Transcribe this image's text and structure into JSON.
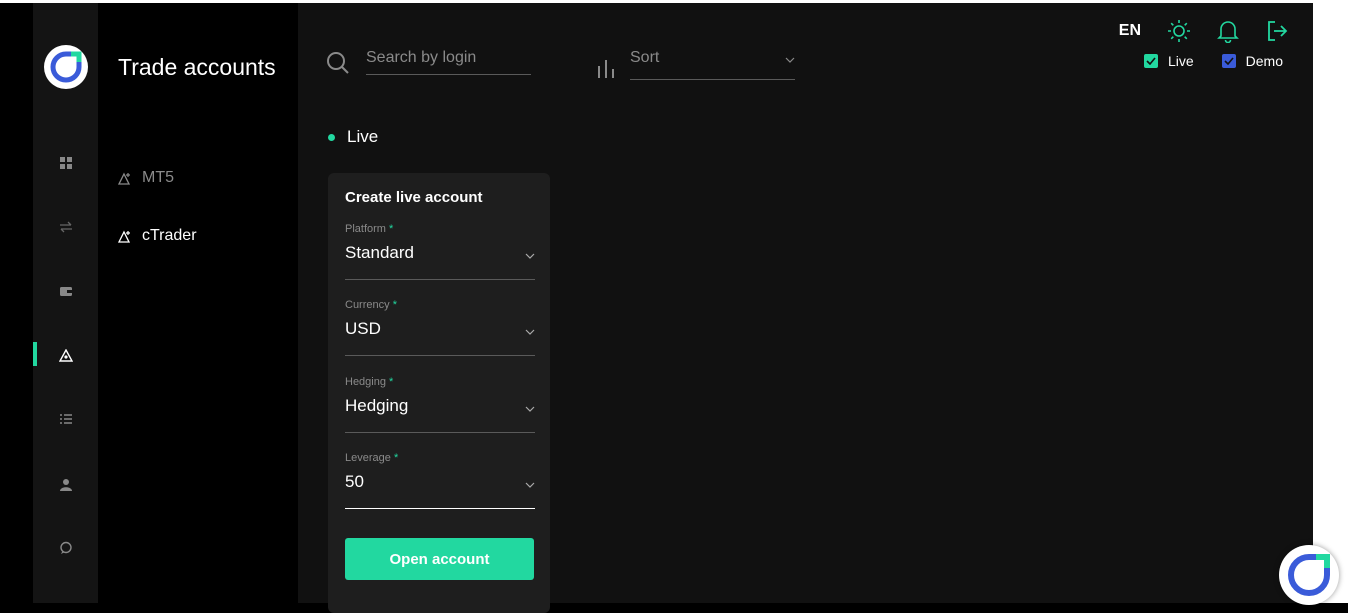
{
  "colors": {
    "accent": "#22d8a0",
    "demo": "#3a5bd9",
    "rail_bg": "#141414",
    "main_bg": "#111111",
    "card_bg": "#1e1e1e"
  },
  "rail": {
    "items": [
      {
        "icon": "grid-icon"
      },
      {
        "icon": "transfer-icon"
      },
      {
        "icon": "wallet-icon"
      },
      {
        "icon": "trade-accounts-icon",
        "active": true
      },
      {
        "icon": "list-icon"
      },
      {
        "icon": "profile-icon"
      },
      {
        "icon": "chat-icon"
      }
    ]
  },
  "menu": {
    "title": "Trade accounts",
    "items": [
      {
        "label": "MT5",
        "icon": "trade-accounts-icon",
        "active": false
      },
      {
        "label": "cTrader",
        "icon": "trade-accounts-icon",
        "active": true
      }
    ]
  },
  "search": {
    "placeholder": "Search by login"
  },
  "sort": {
    "placeholder": "Sort"
  },
  "header": {
    "lang": "EN",
    "toggles": [
      {
        "label": "Live",
        "checked": true,
        "color": "#22d8a0"
      },
      {
        "label": "Demo",
        "checked": true,
        "color": "#3a5bd9"
      }
    ]
  },
  "section": {
    "label": "Live"
  },
  "card": {
    "title": "Create live account",
    "fields": [
      {
        "label": "Platform",
        "value": "Standard"
      },
      {
        "label": "Currency",
        "value": "USD"
      },
      {
        "label": "Hedging",
        "value": "Hedging"
      },
      {
        "label": "Leverage",
        "value": "50"
      }
    ],
    "submit_label": "Open account"
  }
}
